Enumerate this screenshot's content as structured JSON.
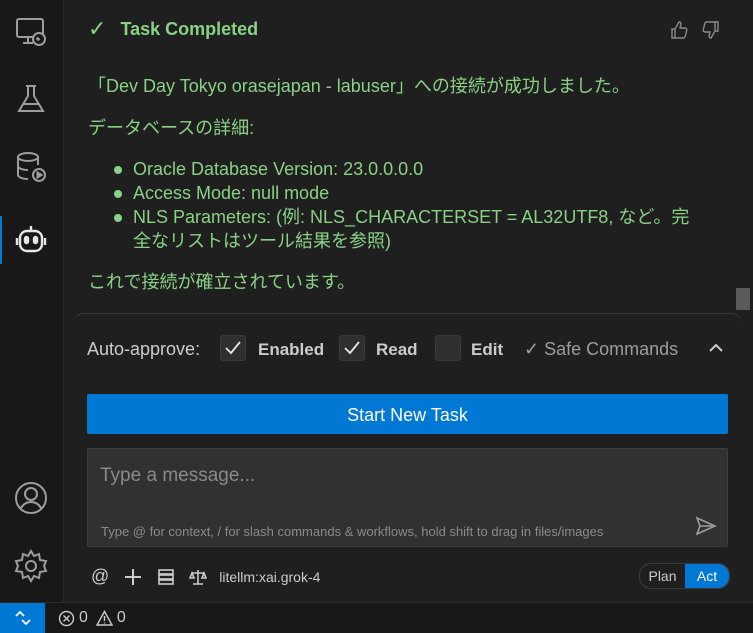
{
  "activity_bar": {
    "items": [
      {
        "icon": "remote-explorer-icon"
      },
      {
        "icon": "testing-flask-icon"
      },
      {
        "icon": "database-icon"
      },
      {
        "icon": "robot-icon",
        "active": true
      }
    ],
    "bottom": [
      {
        "icon": "account-icon"
      },
      {
        "icon": "settings-gear-icon"
      }
    ]
  },
  "task": {
    "status": "Task Completed"
  },
  "message": {
    "line1": "「Dev Day Tokyo orasejapan - labuser」への接続が成功しました。",
    "details_heading": "データベースの詳細:",
    "bullets": [
      "Oracle Database Version: 23.0.0.0.0",
      "Access Mode: null mode",
      "NLS Parameters: (例: NLS_CHARACTERSET = AL32UTF8, など。完全なリストはツール結果を参照)"
    ],
    "closing": "これで接続が確立されています。"
  },
  "auto_approve": {
    "label": "Auto-approve:",
    "options": [
      {
        "label": "Enabled",
        "checked": true
      },
      {
        "label": "Read",
        "checked": true
      },
      {
        "label": "Edit",
        "checked": false
      }
    ],
    "safe_commands": "✓ Safe Commands"
  },
  "start_button": "Start New Task",
  "input": {
    "placeholder": "Type a message...",
    "hint": "Type @ for context, / for slash commands & workflows, hold shift to drag in files/images"
  },
  "toolbar": {
    "at": "@",
    "model": "litellm:xai.grok-4"
  },
  "mode": {
    "plan": "Plan",
    "act": "Act",
    "selected": "Act"
  },
  "status_bar": {
    "errors": "0",
    "warnings": "0"
  },
  "colors": {
    "accent": "#0078d4",
    "success_text": "#89d185",
    "background": "#1f1f1f"
  }
}
